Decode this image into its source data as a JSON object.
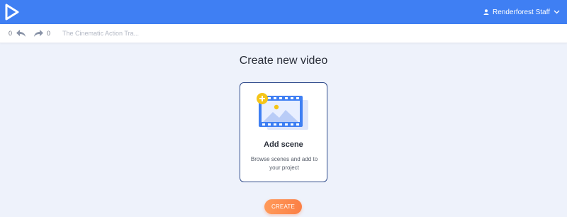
{
  "app": {
    "brand_color": "#3f7ff3",
    "logo_icon": "play-triangle-logo-icon"
  },
  "header": {
    "user_name": "Renderforest Staff",
    "user_icon": "user-icon",
    "menu_icon": "chevron-down-icon"
  },
  "toolbar": {
    "undo_count": "0",
    "redo_count": "0",
    "undo_icon": "undo-arrow-icon",
    "redo_icon": "redo-arrow-icon",
    "project_title": "The Cinematic Action Tra..."
  },
  "main": {
    "heading": "Create new video",
    "add_scene": {
      "title": "Add scene",
      "description": "Browse scenes and add to your project",
      "icon": "add-scene-film-icon",
      "border_color": "#2e4a8a"
    },
    "create_button": "CREATE",
    "create_button_color": "#fb7f45"
  }
}
